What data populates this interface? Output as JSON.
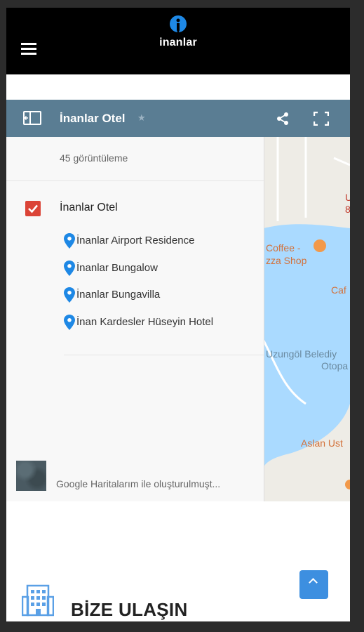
{
  "header": {
    "logo_text": "inanlar",
    "menu_icon": "hamburger-menu-icon"
  },
  "map": {
    "title": "İnanlar Otel",
    "views": "45 görüntüleme",
    "layer": {
      "name": "İnanlar Otel",
      "checked": true,
      "places": [
        {
          "label": "İnanlar Airport Residence"
        },
        {
          "label": "İnanlar Bungalow"
        },
        {
          "label": "İnanlar Bungavilla"
        },
        {
          "label": "İnan Kardesler Hüseyin Hotel"
        }
      ]
    },
    "credit": "Google Haritalarım ile oluşturulmuşt...",
    "map_labels": [
      "U",
      "8",
      "Coffee -",
      "zza Shop",
      "Caf",
      "Uzungöl Belediy",
      "Otopa",
      "Aslan Ust"
    ],
    "colors": {
      "header": "#5a7d93",
      "water": "#aadaff",
      "checkbox": "#db4437",
      "pin": "#1e88e5"
    }
  },
  "scroll_top": {
    "icon": "chevron-up-icon"
  },
  "contact": {
    "title": "BİZE ULAŞIN",
    "icon": "building-icon"
  }
}
